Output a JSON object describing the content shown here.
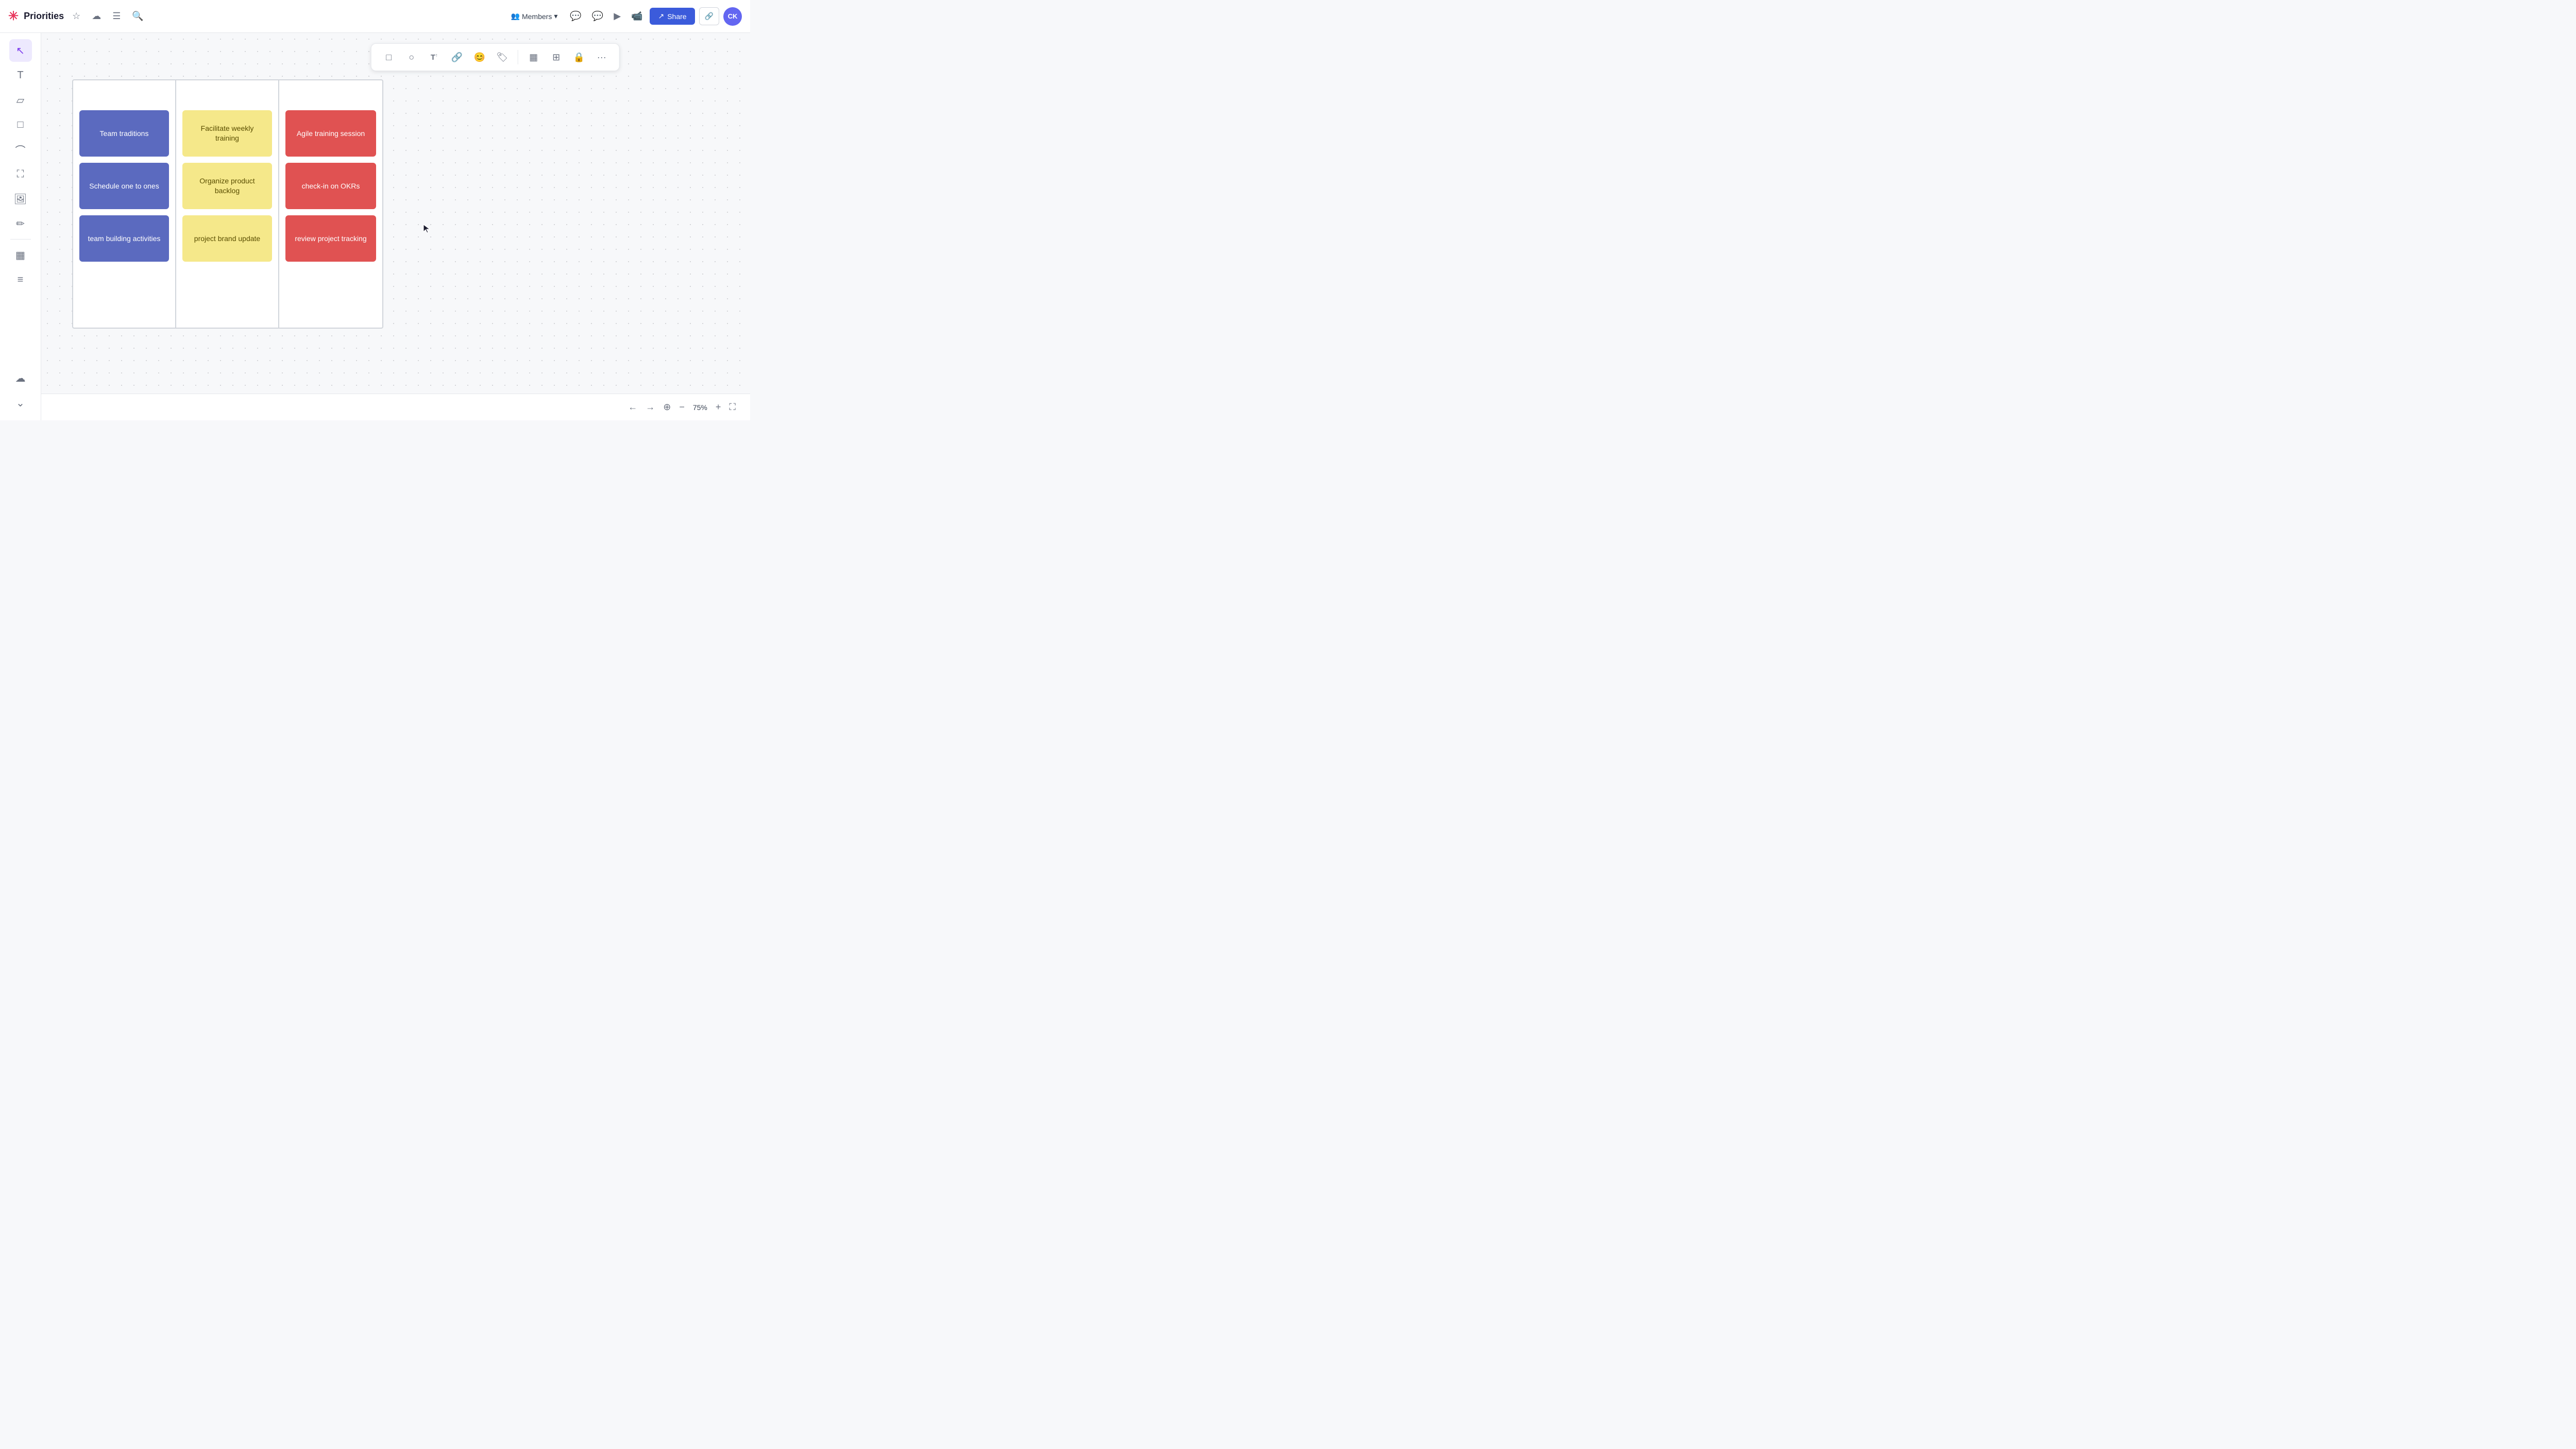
{
  "header": {
    "title": "Priorities",
    "star_icon": "☆",
    "history_icon": "⟲",
    "menu_icon": "☰",
    "search_icon": "🔍",
    "members_label": "Members",
    "share_label": "Share",
    "avatar_initials": "CK"
  },
  "sidebar": {
    "tools": [
      {
        "id": "select",
        "icon": "↖",
        "active": true
      },
      {
        "id": "text",
        "icon": "T"
      },
      {
        "id": "sticky",
        "icon": "▭"
      },
      {
        "id": "frame",
        "icon": "□"
      },
      {
        "id": "curve",
        "icon": "⌒"
      },
      {
        "id": "crop",
        "icon": "⛶"
      },
      {
        "id": "image",
        "icon": "🖼"
      },
      {
        "id": "pen",
        "icon": "✏"
      },
      {
        "id": "table",
        "icon": "▦"
      },
      {
        "id": "more",
        "icon": "···"
      }
    ],
    "bottom_tools": [
      {
        "id": "hand",
        "icon": "☁"
      },
      {
        "id": "expand",
        "icon": "⌄"
      }
    ]
  },
  "floating_toolbar": {
    "tools": [
      {
        "id": "rectangle",
        "icon": "□"
      },
      {
        "id": "circle",
        "icon": "○"
      },
      {
        "id": "text-tool",
        "icon": "T↑"
      },
      {
        "id": "link",
        "icon": "🔗"
      },
      {
        "id": "emoji",
        "icon": "😊"
      },
      {
        "id": "tag",
        "icon": "🏷"
      },
      {
        "id": "grid",
        "icon": "▦"
      },
      {
        "id": "table2",
        "icon": "⊞"
      },
      {
        "id": "lock",
        "icon": "🔒"
      },
      {
        "id": "more2",
        "icon": "···"
      }
    ]
  },
  "kanban": {
    "columns": [
      {
        "id": "col1",
        "cards": [
          {
            "id": "card1",
            "text": "Team traditions",
            "color": "blue"
          },
          {
            "id": "card2",
            "text": "Schedule one to ones",
            "color": "blue"
          },
          {
            "id": "card3",
            "text": "team building activities",
            "color": "blue"
          }
        ]
      },
      {
        "id": "col2",
        "cards": [
          {
            "id": "card4",
            "text": "Facilitate weekly training",
            "color": "yellow"
          },
          {
            "id": "card5",
            "text": "Organize product backlog",
            "color": "yellow"
          },
          {
            "id": "card6",
            "text": "project brand update",
            "color": "yellow"
          }
        ]
      },
      {
        "id": "col3",
        "cards": [
          {
            "id": "card7",
            "text": "Agile training session",
            "color": "red"
          },
          {
            "id": "card8",
            "text": "check-in on OKRs",
            "color": "red"
          },
          {
            "id": "card9",
            "text": "review project tracking",
            "color": "red"
          }
        ]
      }
    ]
  },
  "bottom_bar": {
    "undo_icon": "←",
    "redo_icon": "→",
    "home_icon": "⊕",
    "zoom_minus": "−",
    "zoom_level": "75%",
    "zoom_plus": "+",
    "fullscreen_icon": "⛶"
  }
}
